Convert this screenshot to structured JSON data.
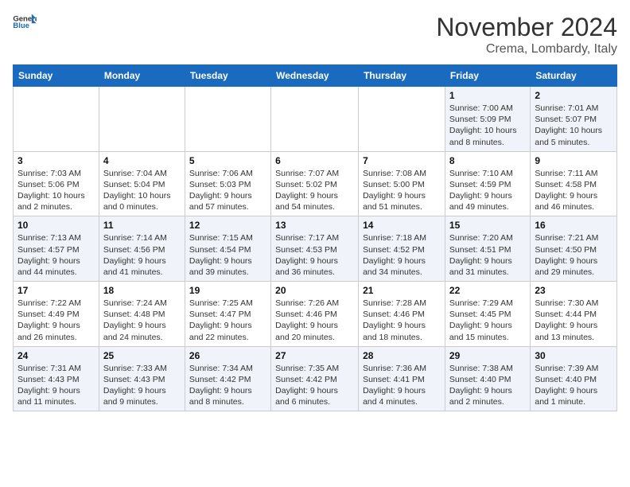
{
  "header": {
    "logo_general": "General",
    "logo_blue": "Blue",
    "month_title": "November 2024",
    "location": "Crema, Lombardy, Italy"
  },
  "weekdays": [
    "Sunday",
    "Monday",
    "Tuesday",
    "Wednesday",
    "Thursday",
    "Friday",
    "Saturday"
  ],
  "weeks": [
    [
      {
        "day": "",
        "info": ""
      },
      {
        "day": "",
        "info": ""
      },
      {
        "day": "",
        "info": ""
      },
      {
        "day": "",
        "info": ""
      },
      {
        "day": "",
        "info": ""
      },
      {
        "day": "1",
        "info": "Sunrise: 7:00 AM\nSunset: 5:09 PM\nDaylight: 10 hours\nand 8 minutes."
      },
      {
        "day": "2",
        "info": "Sunrise: 7:01 AM\nSunset: 5:07 PM\nDaylight: 10 hours\nand 5 minutes."
      }
    ],
    [
      {
        "day": "3",
        "info": "Sunrise: 7:03 AM\nSunset: 5:06 PM\nDaylight: 10 hours\nand 2 minutes."
      },
      {
        "day": "4",
        "info": "Sunrise: 7:04 AM\nSunset: 5:04 PM\nDaylight: 10 hours\nand 0 minutes."
      },
      {
        "day": "5",
        "info": "Sunrise: 7:06 AM\nSunset: 5:03 PM\nDaylight: 9 hours\nand 57 minutes."
      },
      {
        "day": "6",
        "info": "Sunrise: 7:07 AM\nSunset: 5:02 PM\nDaylight: 9 hours\nand 54 minutes."
      },
      {
        "day": "7",
        "info": "Sunrise: 7:08 AM\nSunset: 5:00 PM\nDaylight: 9 hours\nand 51 minutes."
      },
      {
        "day": "8",
        "info": "Sunrise: 7:10 AM\nSunset: 4:59 PM\nDaylight: 9 hours\nand 49 minutes."
      },
      {
        "day": "9",
        "info": "Sunrise: 7:11 AM\nSunset: 4:58 PM\nDaylight: 9 hours\nand 46 minutes."
      }
    ],
    [
      {
        "day": "10",
        "info": "Sunrise: 7:13 AM\nSunset: 4:57 PM\nDaylight: 9 hours\nand 44 minutes."
      },
      {
        "day": "11",
        "info": "Sunrise: 7:14 AM\nSunset: 4:56 PM\nDaylight: 9 hours\nand 41 minutes."
      },
      {
        "day": "12",
        "info": "Sunrise: 7:15 AM\nSunset: 4:54 PM\nDaylight: 9 hours\nand 39 minutes."
      },
      {
        "day": "13",
        "info": "Sunrise: 7:17 AM\nSunset: 4:53 PM\nDaylight: 9 hours\nand 36 minutes."
      },
      {
        "day": "14",
        "info": "Sunrise: 7:18 AM\nSunset: 4:52 PM\nDaylight: 9 hours\nand 34 minutes."
      },
      {
        "day": "15",
        "info": "Sunrise: 7:20 AM\nSunset: 4:51 PM\nDaylight: 9 hours\nand 31 minutes."
      },
      {
        "day": "16",
        "info": "Sunrise: 7:21 AM\nSunset: 4:50 PM\nDaylight: 9 hours\nand 29 minutes."
      }
    ],
    [
      {
        "day": "17",
        "info": "Sunrise: 7:22 AM\nSunset: 4:49 PM\nDaylight: 9 hours\nand 26 minutes."
      },
      {
        "day": "18",
        "info": "Sunrise: 7:24 AM\nSunset: 4:48 PM\nDaylight: 9 hours\nand 24 minutes."
      },
      {
        "day": "19",
        "info": "Sunrise: 7:25 AM\nSunset: 4:47 PM\nDaylight: 9 hours\nand 22 minutes."
      },
      {
        "day": "20",
        "info": "Sunrise: 7:26 AM\nSunset: 4:46 PM\nDaylight: 9 hours\nand 20 minutes."
      },
      {
        "day": "21",
        "info": "Sunrise: 7:28 AM\nSunset: 4:46 PM\nDaylight: 9 hours\nand 18 minutes."
      },
      {
        "day": "22",
        "info": "Sunrise: 7:29 AM\nSunset: 4:45 PM\nDaylight: 9 hours\nand 15 minutes."
      },
      {
        "day": "23",
        "info": "Sunrise: 7:30 AM\nSunset: 4:44 PM\nDaylight: 9 hours\nand 13 minutes."
      }
    ],
    [
      {
        "day": "24",
        "info": "Sunrise: 7:31 AM\nSunset: 4:43 PM\nDaylight: 9 hours\nand 11 minutes."
      },
      {
        "day": "25",
        "info": "Sunrise: 7:33 AM\nSunset: 4:43 PM\nDaylight: 9 hours\nand 9 minutes."
      },
      {
        "day": "26",
        "info": "Sunrise: 7:34 AM\nSunset: 4:42 PM\nDaylight: 9 hours\nand 8 minutes."
      },
      {
        "day": "27",
        "info": "Sunrise: 7:35 AM\nSunset: 4:42 PM\nDaylight: 9 hours\nand 6 minutes."
      },
      {
        "day": "28",
        "info": "Sunrise: 7:36 AM\nSunset: 4:41 PM\nDaylight: 9 hours\nand 4 minutes."
      },
      {
        "day": "29",
        "info": "Sunrise: 7:38 AM\nSunset: 4:40 PM\nDaylight: 9 hours\nand 2 minutes."
      },
      {
        "day": "30",
        "info": "Sunrise: 7:39 AM\nSunset: 4:40 PM\nDaylight: 9 hours\nand 1 minute."
      }
    ]
  ]
}
